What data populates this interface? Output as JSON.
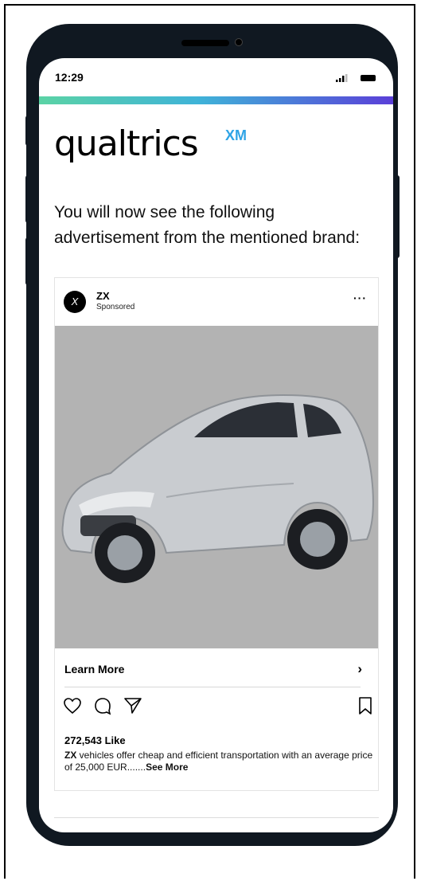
{
  "status_bar": {
    "time": "12:29"
  },
  "brand": {
    "logo_text": "qualtrics",
    "logo_suffix": "XM"
  },
  "survey": {
    "intro_text": "You will now see the following advertisement from the mentioned brand:"
  },
  "ad": {
    "brand_name": "ZX",
    "sponsored_label": "Sponsored",
    "more_label": "···",
    "cta_label": "Learn More",
    "cta_chevron": "›",
    "likes": "272,543 Like",
    "caption_brand": "ZX",
    "caption_text": " vehicles offer cheap and efficient transportation with an average price of 25,000 EUR.......",
    "see_more_label": "See More",
    "image_description_icon": "car-image",
    "colors": {
      "image_bg": "#b3b3b3",
      "car_body": "#c9ccd0"
    }
  },
  "colors": {
    "accent_gradient": [
      "#5bd3a5",
      "#3fb3d8",
      "#5a3fd8"
    ],
    "logo_xm": "#2ea4e6"
  }
}
